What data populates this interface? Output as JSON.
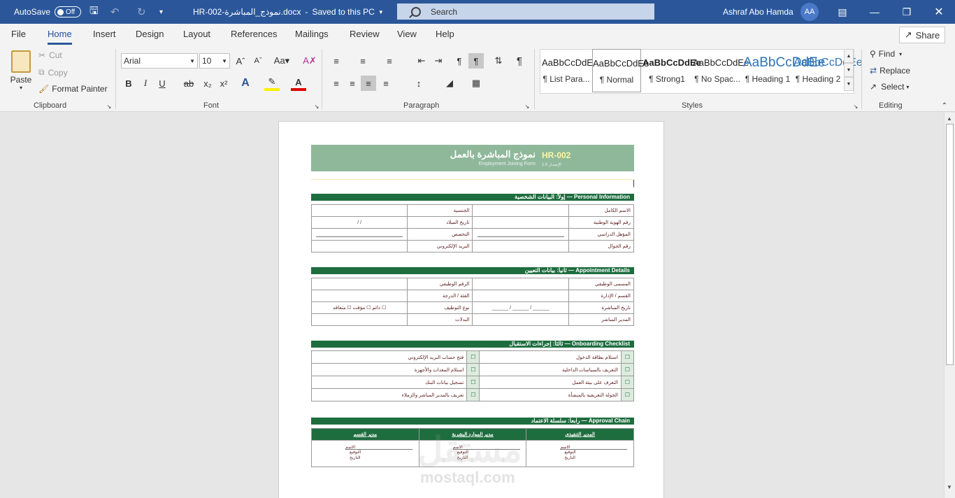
{
  "titlebar": {
    "autosave_label": "AutoSave",
    "autosave_state": "Off",
    "doc_title": "HR-002-نموذج_المباشرة.docx",
    "saved_status": "Saved to this PC",
    "search_placeholder": "Search",
    "user_name": "Ashraf Abo Hamda",
    "user_initials": "AA",
    "accent_color": "#2b579a"
  },
  "menu": {
    "tabs": [
      "File",
      "Home",
      "Insert",
      "Design",
      "Layout",
      "References",
      "Mailings",
      "Review",
      "View",
      "Help"
    ],
    "active": "Home",
    "share_label": "Share"
  },
  "ribbon": {
    "clipboard": {
      "paste": "Paste",
      "cut": "Cut",
      "copy": "Copy",
      "format_painter": "Format Painter",
      "label": "Clipboard"
    },
    "font": {
      "name": "Arial",
      "size": "10",
      "label": "Font"
    },
    "paragraph": {
      "label": "Paragraph"
    },
    "styles": {
      "label": "Styles",
      "items": [
        {
          "sample": "AaBbCcDdEe",
          "name": "¶ List Para..."
        },
        {
          "sample": "AaBbCcDdEe",
          "name": "¶ Normal"
        },
        {
          "sample": "AaBbCcDdEe",
          "name": "¶ Strong1"
        },
        {
          "sample": "AaBbCcDdEe",
          "name": "¶ No Spac..."
        },
        {
          "sample": "AaBbCcDdEe",
          "name": "¶ Heading 1"
        },
        {
          "sample": "AaBbCcDdEe",
          "name": "¶ Heading 2"
        }
      ]
    },
    "editing": {
      "find": "Find",
      "replace": "Replace",
      "select": "Select",
      "label": "Editing"
    }
  },
  "document": {
    "header": {
      "code": "HR-002",
      "title_ar": "نموذج المباشرة بالعمل",
      "subtitle_en": "Employment Joining Form",
      "version": "الإصدار 1.0"
    },
    "sections": {
      "personal": "إولاً: البيانات الشخصية — Personal Information",
      "appointment": "ثانياً: بيانات التعيين — Appointment Details",
      "onboarding": "ثالثاً: إجراءات الاستقبال — Onboarding Checklist",
      "approval": "رابعاً: سلسلة الاعتماد — Approval Chain"
    },
    "personal_rows": [
      {
        "l1": "الاسم الكامل",
        "v1": "",
        "l2": "الجنسية",
        "v2": ""
      },
      {
        "l1": "رقم الهوية الوطنية",
        "v1": "",
        "l2": "تاريخ الميلاد",
        "v2": "/          /"
      },
      {
        "l1": "المؤهل الدراسي",
        "v1": "_",
        "l2": "التخصص",
        "v2": "_"
      },
      {
        "l1": "رقم الجوال",
        "v1": "",
        "l2": "البريد الإلكتروني",
        "v2": ""
      }
    ],
    "appointment_rows": [
      {
        "l1": "المسمى الوظيفي",
        "v1": "",
        "l2": "الرقم الوظيفي",
        "v2": ""
      },
      {
        "l1": "القسم / الإدارة",
        "v1": "",
        "l2": "الفئة / الدرجة",
        "v2": ""
      },
      {
        "l1": "تاريخ المباشرة",
        "v1": "______ / ______ / ______",
        "l2": "نوع التوظيف",
        "v2": "☐ دائم  ☐ مؤقت  ☐ متعاقد"
      },
      {
        "l1": "المدير المباشر",
        "v1": "",
        "l2": "البدلات",
        "v2": ""
      }
    ],
    "onboarding_rows": [
      {
        "a": "استلام بطاقة الدخول",
        "b": "فتح حساب البريد الإلكتروني"
      },
      {
        "a": "التعريف بالسياسات الداخلية",
        "b": "استلام المعدات والأجهزة"
      },
      {
        "a": "التعرف على بيئة العمل",
        "b": "تسجيل بيانات البنك"
      },
      {
        "a": "الجولة التعريفية بالمنشأة",
        "b": "تعريف بالمدير المباشر والزملاء"
      }
    ],
    "checkbox_glyph": "☐",
    "approval": {
      "headers": [
        "مدير القسم",
        "مدير الموارد البشرية",
        "المدير التنفيذي"
      ],
      "sig_name": "الاسم",
      "sig_sign": "التوقيع",
      "sig_date": "التاريخ"
    },
    "watermark": {
      "ar": "مستقل",
      "en": "mostaql.com"
    }
  }
}
